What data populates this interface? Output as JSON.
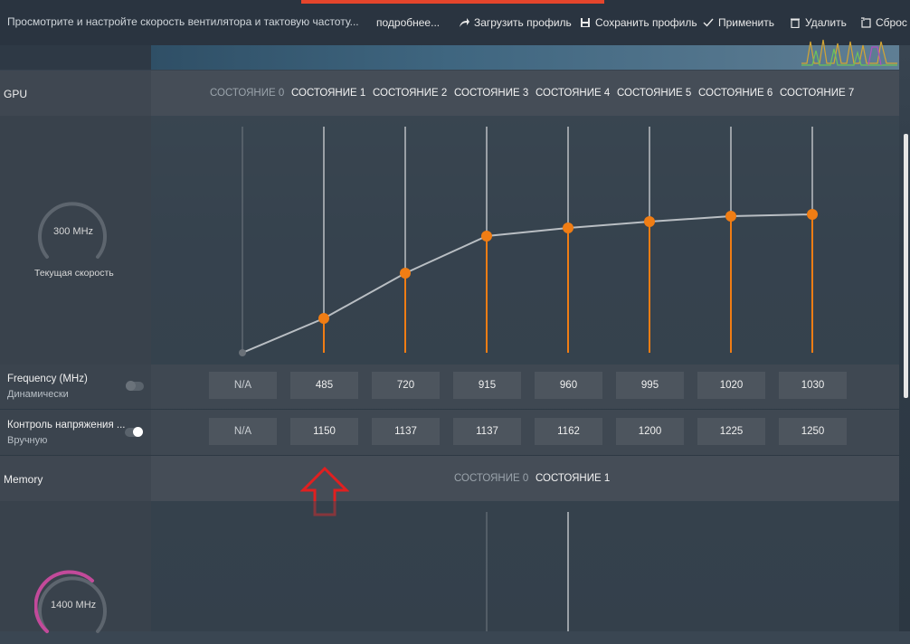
{
  "topbar": {
    "description": "Просмотрите и настройте скорость вентилятора и тактовую частоту...",
    "more": "подробнее...",
    "load_profile": "Загрузить профиль",
    "save_profile": "Сохранить профиль",
    "apply": "Применить",
    "delete": "Удалить",
    "reset": "Сброс"
  },
  "gpu": {
    "label": "GPU",
    "states": [
      "СОСТОЯНИЕ 0",
      "СОСТОЯНИЕ 1",
      "СОСТОЯНИЕ 2",
      "СОСТОЯНИЕ 3",
      "СОСТОЯНИЕ 4",
      "СОСТОЯНИЕ 5",
      "СОСТОЯНИЕ 6",
      "СОСТОЯНИЕ 7"
    ],
    "gauge_value": "300 MHz",
    "gauge_caption": "Текущая скорость",
    "frequency": {
      "title": "Frequency (MHz)",
      "mode": "Динамически",
      "values": [
        "N/A",
        "485",
        "720",
        "915",
        "960",
        "995",
        "1020",
        "1030"
      ]
    },
    "voltage": {
      "title": "Контроль напряжения ...",
      "mode": "Вручную",
      "values": [
        "N/A",
        "1150",
        "1137",
        "1137",
        "1162",
        "1200",
        "1225",
        "1250"
      ]
    }
  },
  "memory": {
    "label": "Memory",
    "states": [
      "СОСТОЯНИЕ 0",
      "СОСТОЯНИЕ 1"
    ],
    "gauge_value": "1400 MHz"
  },
  "colors": {
    "accent": "#f07d14",
    "alert": "#e02020",
    "memory_gauge": "#c24a9a"
  }
}
